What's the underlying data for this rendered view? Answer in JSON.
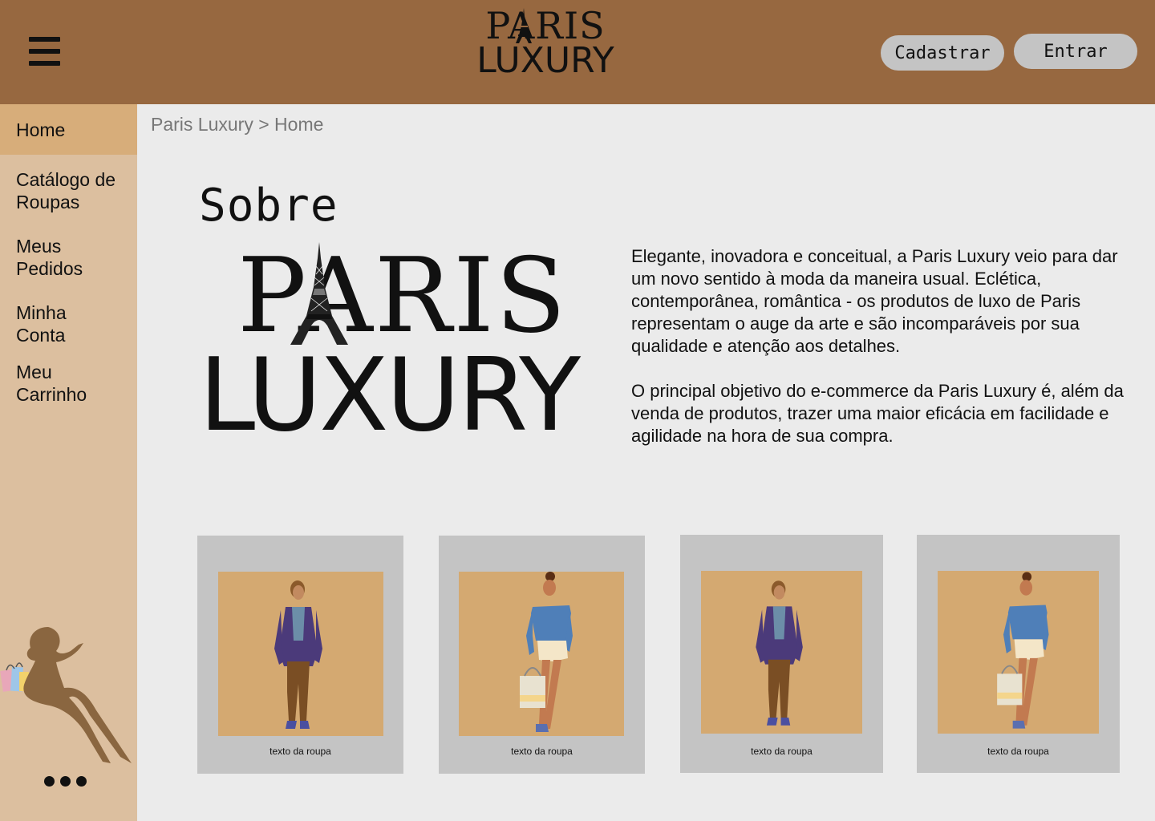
{
  "header": {
    "logo_line1": "PARIS",
    "logo_line2": "LUXURY",
    "cadastrar_label": "Cadastrar",
    "entrar_label": "Entrar"
  },
  "sidebar": {
    "items": [
      {
        "label": "Home",
        "active": true
      },
      {
        "label": "Catálogo de Roupas"
      },
      {
        "label": "Meus Pedidos"
      },
      {
        "label": "Minha Conta"
      },
      {
        "label": "Meu Carrinho"
      }
    ]
  },
  "breadcrumb": "Paris Luxury > Home",
  "about": {
    "heading": "Sobre",
    "logo_line1": "PARIS",
    "logo_line2": "LUXURY",
    "paragraph1": "Elegante, inovadora e conceitual, a Paris Luxury veio para dar um novo sentido à moda da maneira usual. Eclética, contemporânea, romântica - os produtos de luxo de Paris representam o auge da arte e são incomparáveis por sua qualidade e atenção aos detalhes.",
    "paragraph2": "O principal objetivo do e-commerce da Paris Luxury é, além da venda de produtos, trazer uma maior eficácia em facilidade e agilidade na hora de sua compra."
  },
  "products": [
    {
      "caption": "texto da roupa",
      "figure": "man"
    },
    {
      "caption": "texto da roupa",
      "figure": "woman"
    },
    {
      "caption": "texto da roupa",
      "figure": "man"
    },
    {
      "caption": "texto da roupa",
      "figure": "woman"
    }
  ],
  "colors": {
    "header": "#976840",
    "sidebar": "#dcbf9f",
    "sidebar_active": "#d7ad7a",
    "card": "#c4c4c4",
    "card_image": "#d4a971"
  }
}
